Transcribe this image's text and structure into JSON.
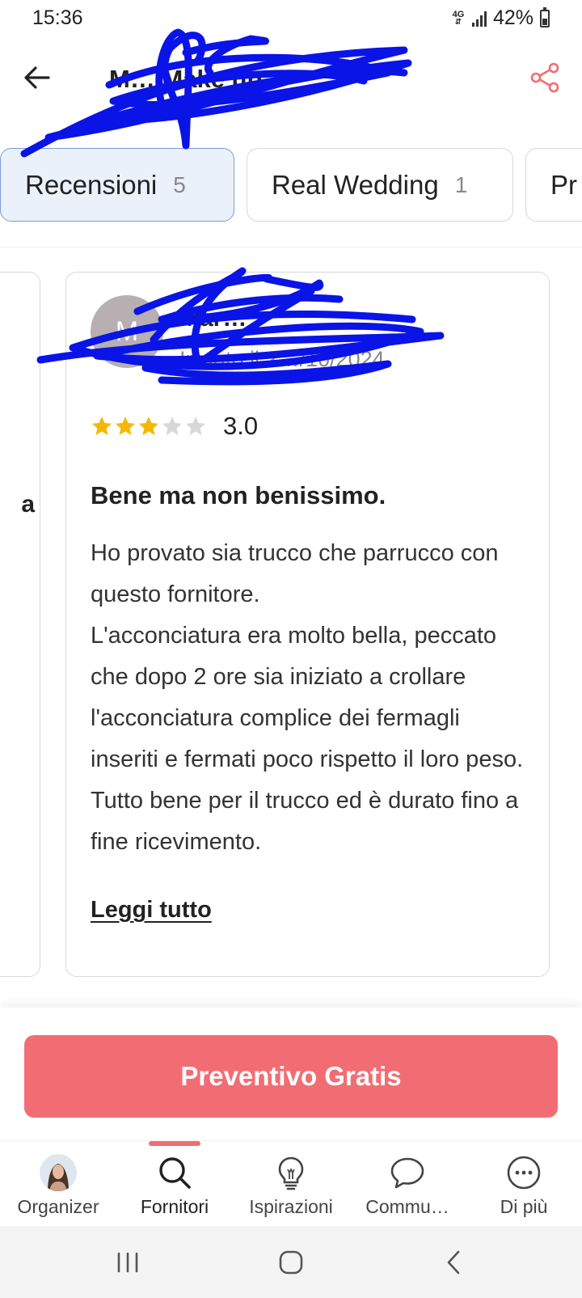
{
  "status_bar": {
    "time": "15:36",
    "network": "4G",
    "battery": "42%",
    "battery_level": 0.42
  },
  "header": {
    "title": "M… Make up",
    "back_icon": "back-arrow-icon",
    "share_icon": "share-icon"
  },
  "tabs": [
    {
      "label": "Recensioni",
      "count": "5",
      "active": true
    },
    {
      "label": "Real Wedding",
      "count": "1",
      "active": false
    },
    {
      "label": "Pr",
      "count": "",
      "active": false
    }
  ],
  "previous_card": {
    "fragment": "a"
  },
  "review": {
    "avatar_initial": "M",
    "reviewer_name": "Mar…",
    "date": "Inviato il 2…/10/2024",
    "rating": 3,
    "rating_max": 5,
    "rating_text": "3.0",
    "title": "Bene ma non benissimo.",
    "body_lines": [
      "Ho provato sia trucco che parrucco con questo fornitore.",
      "L'acconciatura era molto bella, peccato che dopo 2 ore sia iniziato a crollare l'acconciatura complice dei fermagli inseriti e fermati poco rispetto il loro peso. Tutto bene per il trucco ed è durato fino a fine ricevimento."
    ],
    "read_more": "Leggi tutto"
  },
  "cta": {
    "label": "Preventivo Gratis"
  },
  "colors": {
    "accent": "#f26d73",
    "star_filled": "#f5b800",
    "star_empty": "#d8d8d8",
    "tab_active_bg": "#eaf1fb",
    "tab_active_border": "#7b9bd4",
    "redaction": "#0a14e6"
  },
  "bottom_nav": [
    {
      "label": "Organizer",
      "icon": "profile-photo",
      "active": false
    },
    {
      "label": "Fornitori",
      "icon": "search-icon",
      "active": true
    },
    {
      "label": "Ispirazioni",
      "icon": "lightbulb-icon",
      "active": false
    },
    {
      "label": "Commu…",
      "icon": "chat-bubble-icon",
      "active": false
    },
    {
      "label": "Di più",
      "icon": "more-icon",
      "active": false
    }
  ],
  "system_nav": [
    "recent-apps-icon",
    "home-icon",
    "system-back-icon"
  ]
}
